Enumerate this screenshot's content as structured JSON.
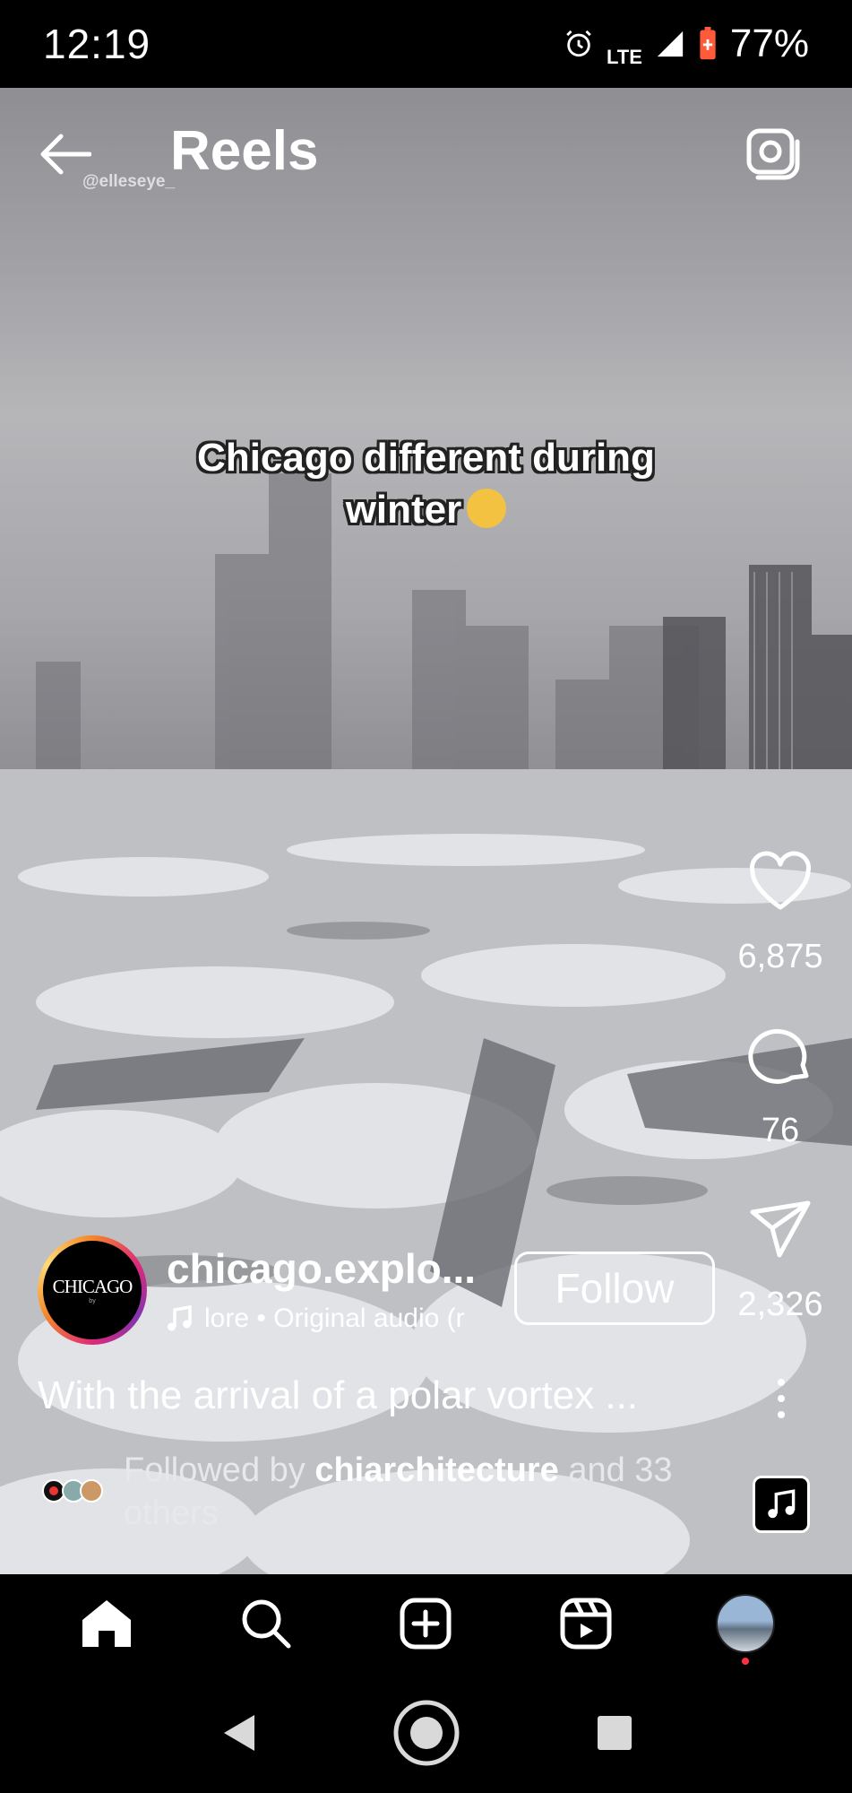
{
  "status_bar": {
    "time": "12:19",
    "network": "LTE",
    "battery": "77%"
  },
  "header": {
    "title": "Reels",
    "watermark": "@elleseye_"
  },
  "overlay": {
    "line1": "Chicago different during",
    "line2": "winter"
  },
  "actions": {
    "likes": "6,875",
    "comments": "76",
    "shares": "2,326"
  },
  "creator": {
    "username": "chicago.explo...",
    "audio": "lore • Original audio (r",
    "follow_label": "Follow",
    "avatar_text": "CHICAGO"
  },
  "caption": "With the arrival of a polar vortex ...",
  "followed_by": {
    "prefix": "Followed by ",
    "name": "chiarchitecture",
    "suffix": " and 33 others"
  },
  "colors": {
    "notification_dot": "#ff3040",
    "background": "#000000"
  },
  "nav": [
    "home-icon",
    "search-icon",
    "create-icon",
    "reels-icon",
    "profile-avatar"
  ]
}
